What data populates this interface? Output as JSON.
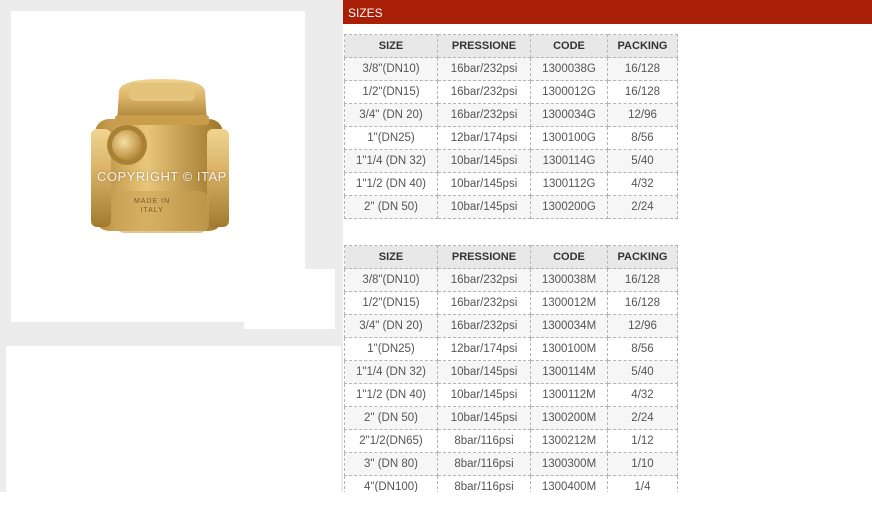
{
  "watermark": "COPYRIGHT © ITAP",
  "valve_stamp": [
    "MADE IN",
    "ITALY"
  ],
  "section_title": "SIZES",
  "table_headers": [
    "SIZE",
    "PRESSIONE",
    "CODE",
    "PACKING"
  ],
  "table1_rows": [
    [
      "3/8\"(DN10)",
      "16bar/232psi",
      "1300038G",
      "16/128"
    ],
    [
      "1/2\"(DN15)",
      "16bar/232psi",
      "1300012G",
      "16/128"
    ],
    [
      "3/4\" (DN 20)",
      "16bar/232psi",
      "1300034G",
      "12/96"
    ],
    [
      "1\"(DN25)",
      "12bar/174psi",
      "1300100G",
      "8/56"
    ],
    [
      "1\"1/4 (DN 32)",
      "10bar/145psi",
      "1300114G",
      "5/40"
    ],
    [
      "1\"1/2 (DN 40)",
      "10bar/145psi",
      "1300112G",
      "4/32"
    ],
    [
      "2\" (DN 50)",
      "10bar/145psi",
      "1300200G",
      "2/24"
    ]
  ],
  "table2_rows": [
    [
      "3/8\"(DN10)",
      "16bar/232psi",
      "1300038M",
      "16/128"
    ],
    [
      "1/2\"(DN15)",
      "16bar/232psi",
      "1300012M",
      "16/128"
    ],
    [
      "3/4\" (DN 20)",
      "16bar/232psi",
      "1300034M",
      "12/96"
    ],
    [
      "1\"(DN25)",
      "12bar/174psi",
      "1300100M",
      "8/56"
    ],
    [
      "1\"1/4 (DN 32)",
      "10bar/145psi",
      "1300114M",
      "5/40"
    ],
    [
      "1\"1/2 (DN 40)",
      "10bar/145psi",
      "1300112M",
      "4/32"
    ],
    [
      "2\" (DN 50)",
      "10bar/145psi",
      "1300200M",
      "2/24"
    ],
    [
      "2\"1/2(DN65)",
      "8bar/116psi",
      "1300212M",
      "1/12"
    ],
    [
      "3\" (DN 80)",
      "8bar/116psi",
      "1300300M",
      "1/10"
    ],
    [
      "4\"(DN100)",
      "8bar/116psi",
      "1300400M",
      "1/4"
    ]
  ],
  "colors": {
    "header_bar": "#a81e06",
    "brass_light": "#e0bd72",
    "brass_dark": "#9a7226"
  }
}
